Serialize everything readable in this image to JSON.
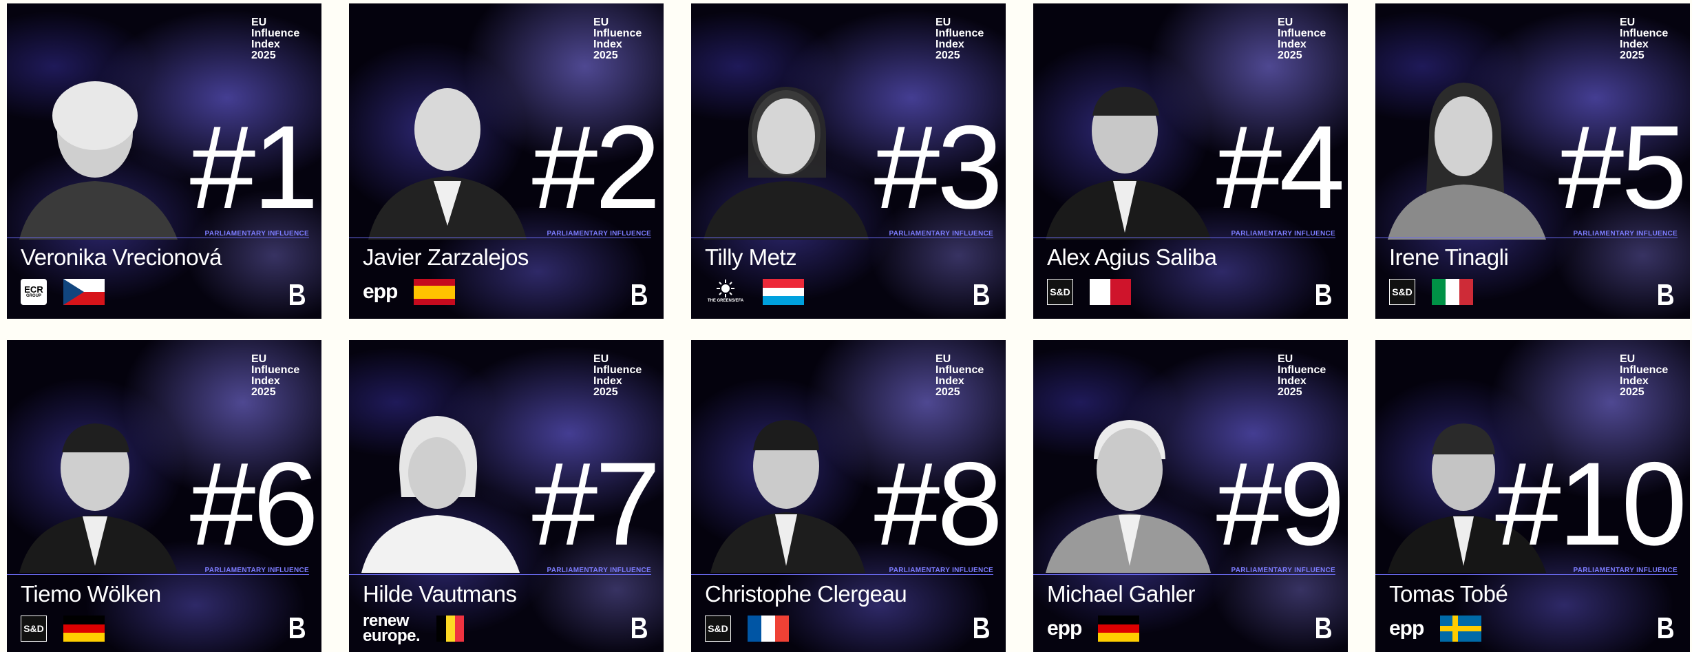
{
  "header": {
    "line1": "EU",
    "line2": "Influence",
    "line3": "Index",
    "line4": "2025"
  },
  "category_label": "PARLIAMENTARY INFLUENCE",
  "colors": {
    "accent": "#7d7dff",
    "divider": "#6a6af0",
    "background": "#fffef7"
  },
  "cards": [
    {
      "rank": "#1",
      "name": "Veronika Vrecionová",
      "party": {
        "type": "ecr",
        "text": "ECR",
        "sub": "GROUP"
      },
      "flag": "czech-flag"
    },
    {
      "rank": "#2",
      "name": "Javier Zarzalejos",
      "party": {
        "type": "epp",
        "text": "epp"
      },
      "flag": "spanish-flag"
    },
    {
      "rank": "#3",
      "name": "Tilly Metz",
      "party": {
        "type": "greens",
        "text": "THE GREENS/EFA"
      },
      "flag": "luxembourg-flag"
    },
    {
      "rank": "#4",
      "name": "Alex Agius Saliba",
      "party": {
        "type": "sd",
        "text": "S&D"
      },
      "flag": "maltese-flag"
    },
    {
      "rank": "#5",
      "name": "Irene Tinagli",
      "party": {
        "type": "sd",
        "text": "S&D"
      },
      "flag": "italian-flag"
    },
    {
      "rank": "#6",
      "name": "Tiemo Wölken",
      "party": {
        "type": "sd",
        "text": "S&D"
      },
      "flag": "german-flag"
    },
    {
      "rank": "#7",
      "name": "Hilde Vautmans",
      "party": {
        "type": "renew",
        "text": "renew",
        "text2": "europe."
      },
      "flag": "belgian-flag"
    },
    {
      "rank": "#8",
      "name": "Christophe Clergeau",
      "party": {
        "type": "sd",
        "text": "S&D"
      },
      "flag": "french-flag"
    },
    {
      "rank": "#9",
      "name": "Michael Gahler",
      "party": {
        "type": "epp",
        "text": "epp"
      },
      "flag": "german-flag"
    },
    {
      "rank": "#10",
      "name": "Tomas Tobé",
      "party": {
        "type": "epp",
        "text": "epp"
      },
      "flag": "swedish-flag"
    }
  ]
}
